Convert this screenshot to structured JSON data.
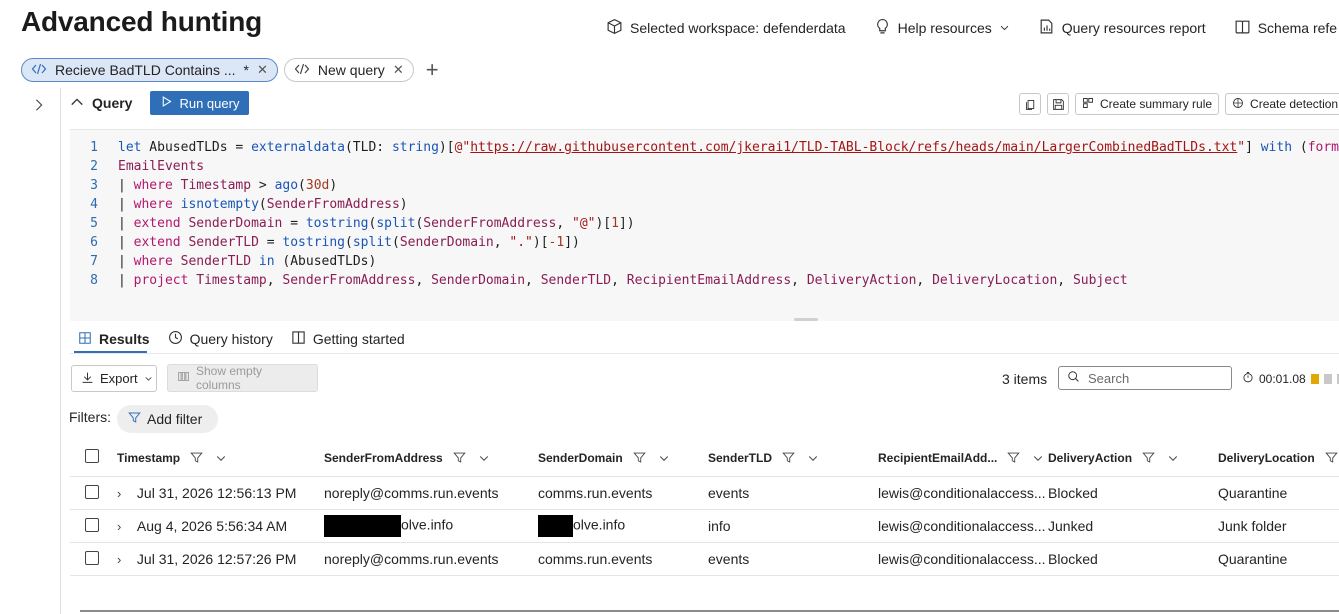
{
  "page": {
    "title": "Advanced hunting"
  },
  "top_links": [
    {
      "label": "Selected workspace: defenderdata",
      "icon": "cube-icon"
    },
    {
      "label": "Help resources",
      "icon": "lightbulb-icon"
    },
    {
      "label": "Query resources report",
      "icon": "report-icon"
    },
    {
      "label": "Schema refe",
      "icon": "book-icon"
    }
  ],
  "tabs": [
    {
      "label": "Recieve BadTLD Contains ...",
      "modified": "*",
      "active": true
    },
    {
      "label": "New query",
      "active": false
    }
  ],
  "query": {
    "label": "Query",
    "run_label": "Run query",
    "create_summary_rule": "Create summary rule",
    "create_detection": "Create detection"
  },
  "code_lines": [
    "let AbusedTLDs = externaldata(TLD: string)[@\"https://raw.githubusercontent.com/jkerai1/TLD-TABL-Block/refs/heads/main/LargerCombinedBadTLDs.txt\"] with (format=",
    "EmailEvents",
    "| where Timestamp > ago(30d)",
    "| where isnotempty(SenderFromAddress)",
    "| extend SenderDomain = tostring(split(SenderFromAddress, \"@\")[1])",
    "| extend SenderTLD = tostring(split(SenderDomain, \".\")[-1])",
    "| where SenderTLD in (AbusedTLDs)",
    "| project Timestamp, SenderFromAddress, SenderDomain, SenderTLD, RecipientEmailAddress, DeliveryAction, DeliveryLocation, Subject"
  ],
  "results_tabs": [
    {
      "label": "Results",
      "icon": "grid-icon",
      "active": true
    },
    {
      "label": "Query history",
      "icon": "clock-icon",
      "active": false
    },
    {
      "label": "Getting started",
      "icon": "book-icon",
      "active": false
    }
  ],
  "toolbar": {
    "export": "Export",
    "show_empty": "Show empty columns",
    "items_count": "3 items",
    "search_placeholder": "Search",
    "timer": "00:01.08"
  },
  "filters": {
    "label": "Filters:",
    "add_filter": "Add filter"
  },
  "table": {
    "columns": [
      "Timestamp",
      "SenderFromAddress",
      "SenderDomain",
      "SenderTLD",
      "RecipientEmailAdd...",
      "DeliveryAction",
      "DeliveryLocation"
    ],
    "rows": [
      {
        "timestamp": "Jul 31, 2026 12:56:13 PM",
        "sender": "noreply@comms.run.events",
        "domain": "comms.run.events",
        "tld": "events",
        "recipient": "lewis@conditionalaccess...",
        "action": "Blocked",
        "location": "Quarantine"
      },
      {
        "timestamp": "Aug 4, 2026 5:56:34 AM",
        "sender": "olve.info",
        "domain": "olve.info",
        "tld": "info",
        "recipient": "lewis@conditionalaccess...",
        "action": "Junked",
        "location": "Junk folder"
      },
      {
        "timestamp": "Jul 31, 2026 12:57:26 PM",
        "sender": "noreply@comms.run.events",
        "domain": "comms.run.events",
        "tld": "events",
        "recipient": "lewis@conditionalaccess...",
        "action": "Blocked",
        "location": "Quarantine"
      }
    ]
  }
}
